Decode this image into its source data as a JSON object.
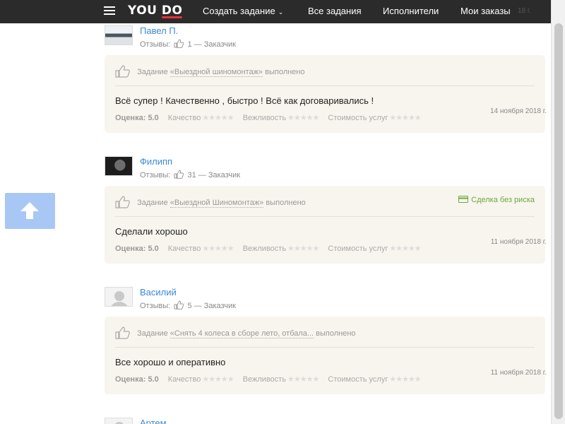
{
  "header": {
    "logo_you": "YOU",
    "logo_do": "DO",
    "nav": [
      "Создать задание",
      "Все задания",
      "Исполнители",
      "Мои заказы"
    ],
    "faded_date": "18 г."
  },
  "labels": {
    "otzyvy": "Отзывы:",
    "customer": "— Заказчик",
    "task_prefix": "Задание",
    "done": "выполнено",
    "score": "Оценка:",
    "quality": "Качество",
    "politeness": "Вежливость",
    "price": "Стоимость услуг",
    "safe_deal": "Сделка без риска"
  },
  "reviews": [
    {
      "name": "Павел П.",
      "count": "1",
      "task": "«Выездной шиномонтаж»",
      "text": "Всё супер ! Качественно , быстро ! Всё как договаривались !",
      "score": "5.0",
      "date": "14 ноября 2018 г."
    },
    {
      "name": "Филипп",
      "count": "31",
      "task": "«Выездной Шиномонтаж»",
      "text": "Сделали хорошо",
      "score": "5.0",
      "date": "11 ноября 2018 г.",
      "safe_deal": true
    },
    {
      "name": "Василий",
      "count": "5",
      "task": "«Снять 4 колеса в сборе лето, отбала...",
      "text": "Все хорошо и оперативно",
      "score": "5.0",
      "date": "11 ноября 2018 г."
    },
    {
      "name": "Артем"
    }
  ],
  "colors": {
    "header_bg": "#2b2b2b",
    "link": "#3a8ad6",
    "card_bg": "#f8f5ee",
    "safe_deal": "#6aa83d",
    "to_top": "#a9c7f5"
  }
}
